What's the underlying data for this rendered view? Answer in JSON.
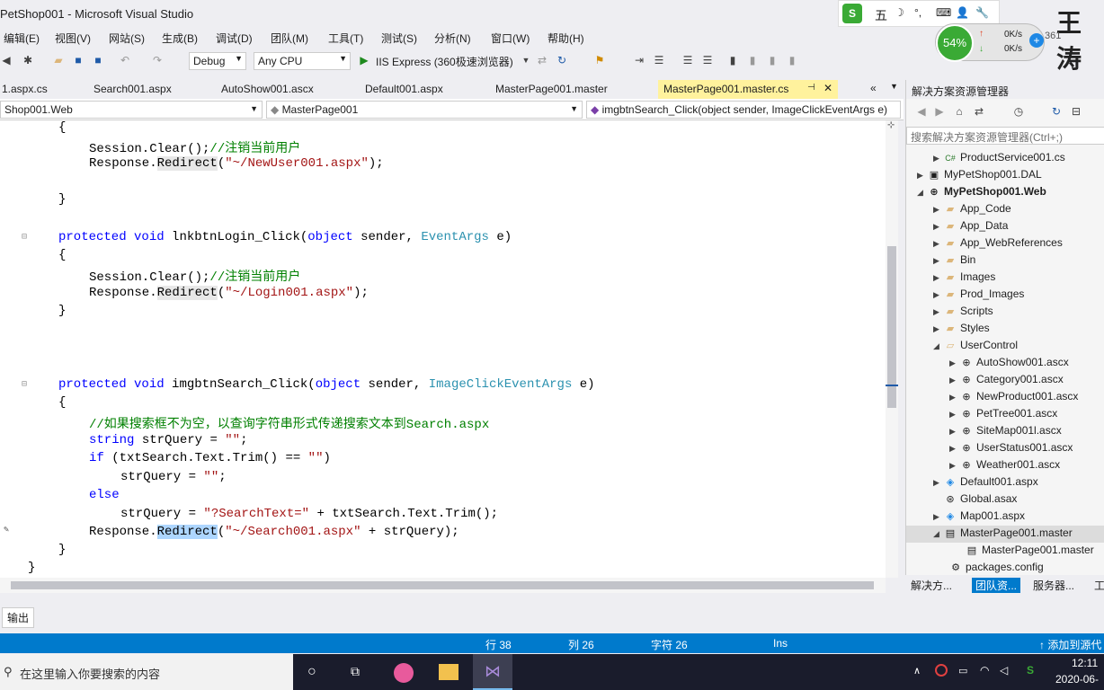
{
  "window": {
    "title": "PetShop001 - Microsoft Visual Studio",
    "watermark": "王涛"
  },
  "menu": [
    "编辑(E)",
    "视图(V)",
    "网站(S)",
    "生成(B)",
    "调试(D)",
    "团队(M)",
    "工具(T)",
    "测试(S)",
    "分析(N)",
    "窗口(W)",
    "帮助(H)"
  ],
  "toolbar": {
    "config": "Debug",
    "platform": "Any CPU",
    "run": "IIS Express (360极速浏览器)"
  },
  "overlay": {
    "percent": "54%",
    "up": "0K/s",
    "down": "0K/s",
    "ime": "五",
    "partial": "361"
  },
  "doc_tabs": [
    "1.aspx.cs",
    "Search001.aspx",
    "AutoShow001.ascx",
    "Default001.aspx",
    "MasterPage001.master",
    "MasterPage001.master.cs"
  ],
  "nav": {
    "project": "Shop001.Web",
    "class": "MasterPage001",
    "member": "imgbtnSearch_Click(object sender, ImageClickEventArgs e)"
  },
  "code": {
    "l1": "{",
    "l2a": "Session.Clear();",
    "l2b": "//注销当前用户",
    "l3a": "Response.",
    "l3b": "Redirect",
    "l3c": "(",
    "l3d": "\"~/NewUser001.aspx\"",
    "l3e": ");",
    "l4": "}",
    "l5a": "protected",
    "l5b": "void",
    "l5c": "lnkbtnLogin_Click(",
    "l5d": "object",
    "l5e": "sender,",
    "l5f": "EventArgs",
    "l5g": "e)",
    "l6": "{",
    "l7a": "Session.Clear();",
    "l7b": "//注销当前用户",
    "l8a": "Response.",
    "l8b": "Redirect",
    "l8c": "(",
    "l8d": "\"~/Login001.aspx\"",
    "l8e": ");",
    "l9": "}",
    "l10a": "protected",
    "l10b": "void",
    "l10c": "imgbtnSearch_Click(",
    "l10d": "object",
    "l10e": "sender,",
    "l10f": "ImageClickEventArgs",
    "l10g": "e)",
    "l11": "{",
    "l12": "//如果搜索框不为空，以查询字符串形式传递搜索文本到Search.aspx",
    "l13a": "string",
    "l13b": "strQuery =",
    "l13c": "\"\"",
    "l13d": ";",
    "l14a": "if",
    "l14b": "(txtSearch.Text.Trim() ==",
    "l14c": "\"\"",
    "l14d": ")",
    "l15a": "strQuery =",
    "l15b": "\"\"",
    "l15c": ";",
    "l16": "else",
    "l17a": "strQuery =",
    "l17b": "\"?SearchText=\"",
    "l17c": "+ txtSearch.Text.Trim();",
    "l18a": "Response.",
    "l18b": "Redirect",
    "l18c": "(",
    "l18d": "\"~/Search001.aspx\"",
    "l18e": "+ strQuery);",
    "l19": "}",
    "l20": "}"
  },
  "solution": {
    "title": "解决方案资源管理器",
    "search": "搜索解决方案资源管理器(Ctrl+;)",
    "items": [
      "ProductService001.cs",
      "MyPetShop001.DAL",
      "MyPetShop001.Web",
      "App_Code",
      "App_Data",
      "App_WebReferences",
      "Bin",
      "Images",
      "Prod_Images",
      "Scripts",
      "Styles",
      "UserControl",
      "AutoShow001.ascx",
      "Category001.ascx",
      "NewProduct001.ascx",
      "PetTree001.ascx",
      "SiteMap001l.ascx",
      "UserStatus001.ascx",
      "Weather001.ascx",
      "Default001.aspx",
      "Global.asax",
      "Map001.aspx",
      "MasterPage001.master",
      "MasterPage001.master",
      "packages.config"
    ],
    "tabs": [
      "解决方...",
      "团队资...",
      "服务器...",
      "工"
    ]
  },
  "output_tab": "输出",
  "status": {
    "line": "行 38",
    "col": "列 26",
    "char": "字符 26",
    "mode": "Ins",
    "publish": "↑ 添加到源代"
  },
  "taskbar": {
    "search": "在这里输入你要搜索的内容",
    "time": "12:11",
    "date": "2020-06-"
  }
}
